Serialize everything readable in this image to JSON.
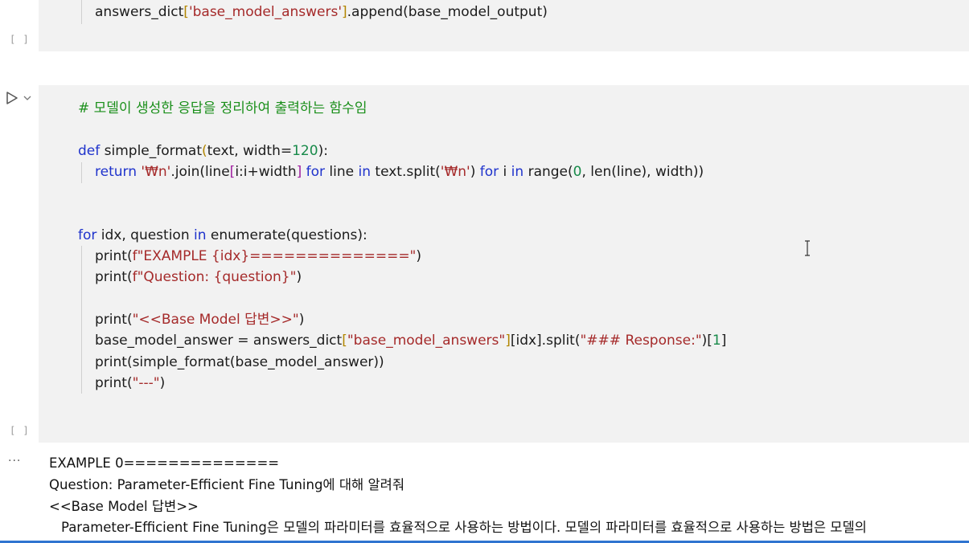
{
  "gutter": {
    "bracket_top": "[ ]",
    "bracket_bottom": "[ ]",
    "output_dots": "···"
  },
  "cell_top": {
    "line1": {
      "p1": "answers_dict",
      "p2": "[",
      "p3": "'base_model_answers'",
      "p4": "]",
      "p5": ".append(base_model_output)"
    }
  },
  "cell_main": {
    "comment": "# 모델이 생성한 응답을 정리하여 출력하는 함수임",
    "def_line": {
      "kw_def": "def",
      "name": " simple_format",
      "open": "(",
      "args": "text, width=",
      "num": "120",
      "close": "):"
    },
    "return_line": {
      "kw_return": "return",
      "s1": " ",
      "str_nl": "'₩n'",
      "s2": ".join(line",
      "br_o": "[",
      "s3": "i:i+width",
      "br_c": "]",
      "s4": " ",
      "kw_for": "for",
      "s5": " line ",
      "kw_in": "in",
      "s6": " text.split(",
      "str_nl2": "'₩n'",
      "s7": ") ",
      "kw_for2": "for",
      "s8": " i ",
      "kw_in2": "in",
      "s9": " range(",
      "num0": "0",
      "s10": ", len(line), width))"
    },
    "for_line": {
      "kw_for": "for",
      "s1": " idx, question ",
      "kw_in": "in",
      "s2": " enumerate(questions):"
    },
    "print1": {
      "fn": "print(",
      "str": "f\"EXAMPLE {idx}==============\"",
      "close": ")"
    },
    "print2": {
      "fn": "print(",
      "str": "f\"Question: {question}\"",
      "close": ")"
    },
    "print3": {
      "fn": "print(",
      "str": "\"<<Base Model 답변>>\"",
      "close": ")"
    },
    "assign_line": {
      "s1": "base_model_answer = answers_dict",
      "br_o": "[",
      "str1": "\"base_model_answers\"",
      "br_c": "]",
      "s2": "[idx].split(",
      "str2": "\"### Response:\"",
      "s3": ")[",
      "num": "1",
      "s4": "]"
    },
    "print4": {
      "text": "print(simple_format(base_model_answer))"
    },
    "print5": {
      "fn": "print(",
      "str": "\"---\"",
      "close": ")"
    }
  },
  "output": {
    "line1": "EXAMPLE 0==============",
    "line2": "Question: Parameter-Efficient Fine Tuning에 대해 알려줘",
    "line3": "<<Base Model 답변>>",
    "line4": "    Parameter-Efficient Fine Tuning은 모델의 파라미터를 효율적으로 사용하는 방법이다. 모델의 파라미터를 효율적으로 사용하는 방법은 모델의"
  },
  "colors": {
    "cell_bg": "#f2f2f2",
    "keyword": "#1f33cc",
    "string": "#a52a2a",
    "number": "#188a4a",
    "comment": "#1a8f1a",
    "accent_bar": "#2f74d0"
  },
  "icons": {
    "run": "play-triangle-icon",
    "expand": "chevron-down-icon",
    "cursor": "text-cursor-icon"
  }
}
